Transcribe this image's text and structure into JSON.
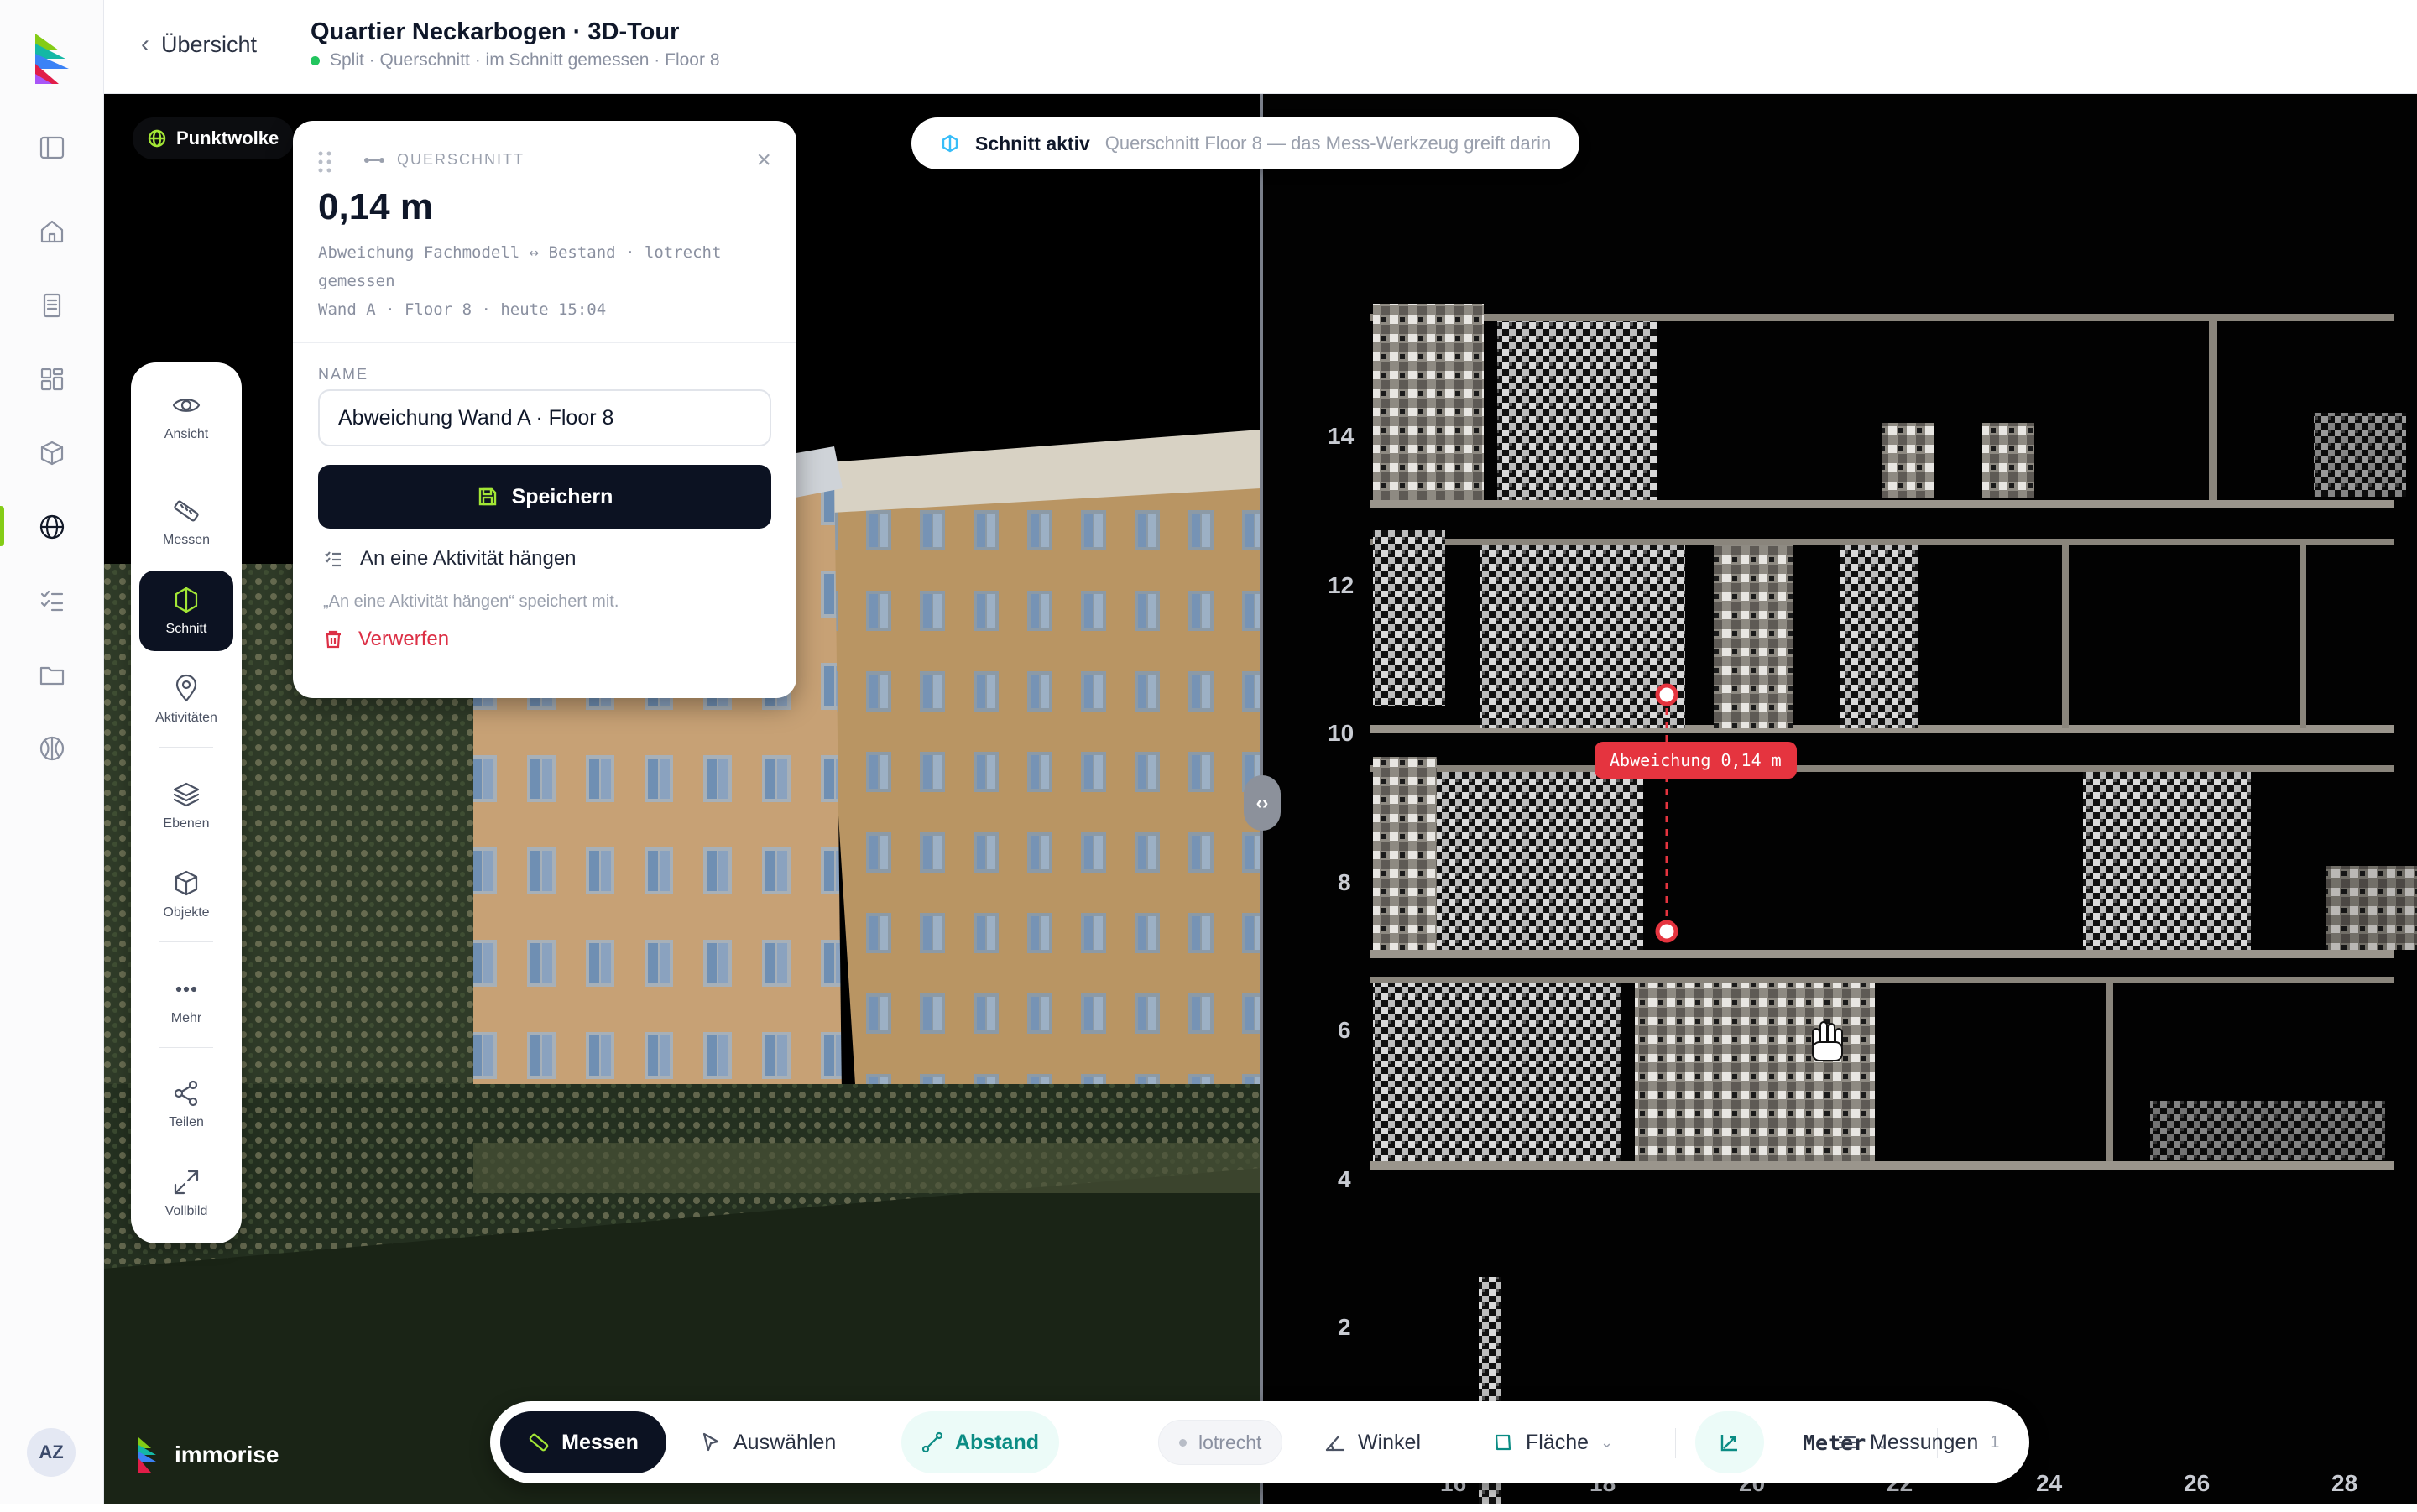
{
  "header": {
    "back_label": "Übersicht",
    "title": "Quartier Neckarbogen · 3D-Tour",
    "subtitle": "Split · Querschnitt · im Schnitt gemessen · Floor 8"
  },
  "rail": {
    "avatar": "AZ",
    "icons": [
      "sidebar-toggle-icon",
      "home-icon",
      "document-icon",
      "grid-icon",
      "cube-icon",
      "globe-icon",
      "checklist-icon",
      "folder-icon",
      "basketball-icon"
    ]
  },
  "viewer": {
    "left_badge": "Punktwolke",
    "schnitt_chip": {
      "title": "Schnitt aktiv",
      "subtitle": "Querschnitt Floor 8 — das Mess-Werkzeug greift darin"
    },
    "split_handle": "‹›",
    "brand": "immorise"
  },
  "vertical_tools": [
    {
      "label": "Ansicht",
      "icon": "eye-icon"
    },
    {
      "label": "Messen",
      "icon": "ruler-icon"
    },
    {
      "label": "Schnitt",
      "icon": "section-icon"
    },
    {
      "label": "Aktivitäten",
      "icon": "pin-icon"
    },
    {
      "label": "Ebenen",
      "icon": "layers-icon"
    },
    {
      "label": "Objekte",
      "icon": "cube-icon"
    },
    {
      "label": "Mehr",
      "icon": "more-icon"
    },
    {
      "label": "Teilen",
      "icon": "share-icon"
    },
    {
      "label": "Vollbild",
      "icon": "fullscreen-icon"
    }
  ],
  "card": {
    "kind": "QUERSCHNITT",
    "value": "0,14 m",
    "description": "Abweichung Fachmodell ↔ Bestand · lotrecht gemessen",
    "meta": "Wand A · Floor 8 · heute 15:04",
    "name_label": "NAME",
    "name_value": "Abweichung Wand A · Floor 8",
    "save_label": "Speichern",
    "attach_label": "An eine Aktivität hängen",
    "hint": "„An eine Aktivität hängen“ speichert mit.",
    "discard_label": "Verwerfen"
  },
  "section": {
    "y_ticks": [
      "14",
      "12",
      "10",
      "8",
      "6",
      "4",
      "2"
    ],
    "x_ticks": [
      "16",
      "18",
      "20",
      "22",
      "24",
      "26",
      "28"
    ],
    "deviation_label": "Abweichung 0,14 m"
  },
  "toolbar": {
    "measure": "Messen",
    "select": "Auswählen",
    "distance": "Abstand",
    "plumb": "lotrecht",
    "angle": "Winkel",
    "area": "Fläche",
    "unit": "Meter",
    "measurements": "Messungen",
    "measurements_count": "1"
  },
  "colors": {
    "accent_lime": "#a3e635",
    "dark_navy": "#0c1222",
    "teal": "#0b8c84",
    "danger": "#dc2f45",
    "deviation_red": "#e5343f"
  }
}
